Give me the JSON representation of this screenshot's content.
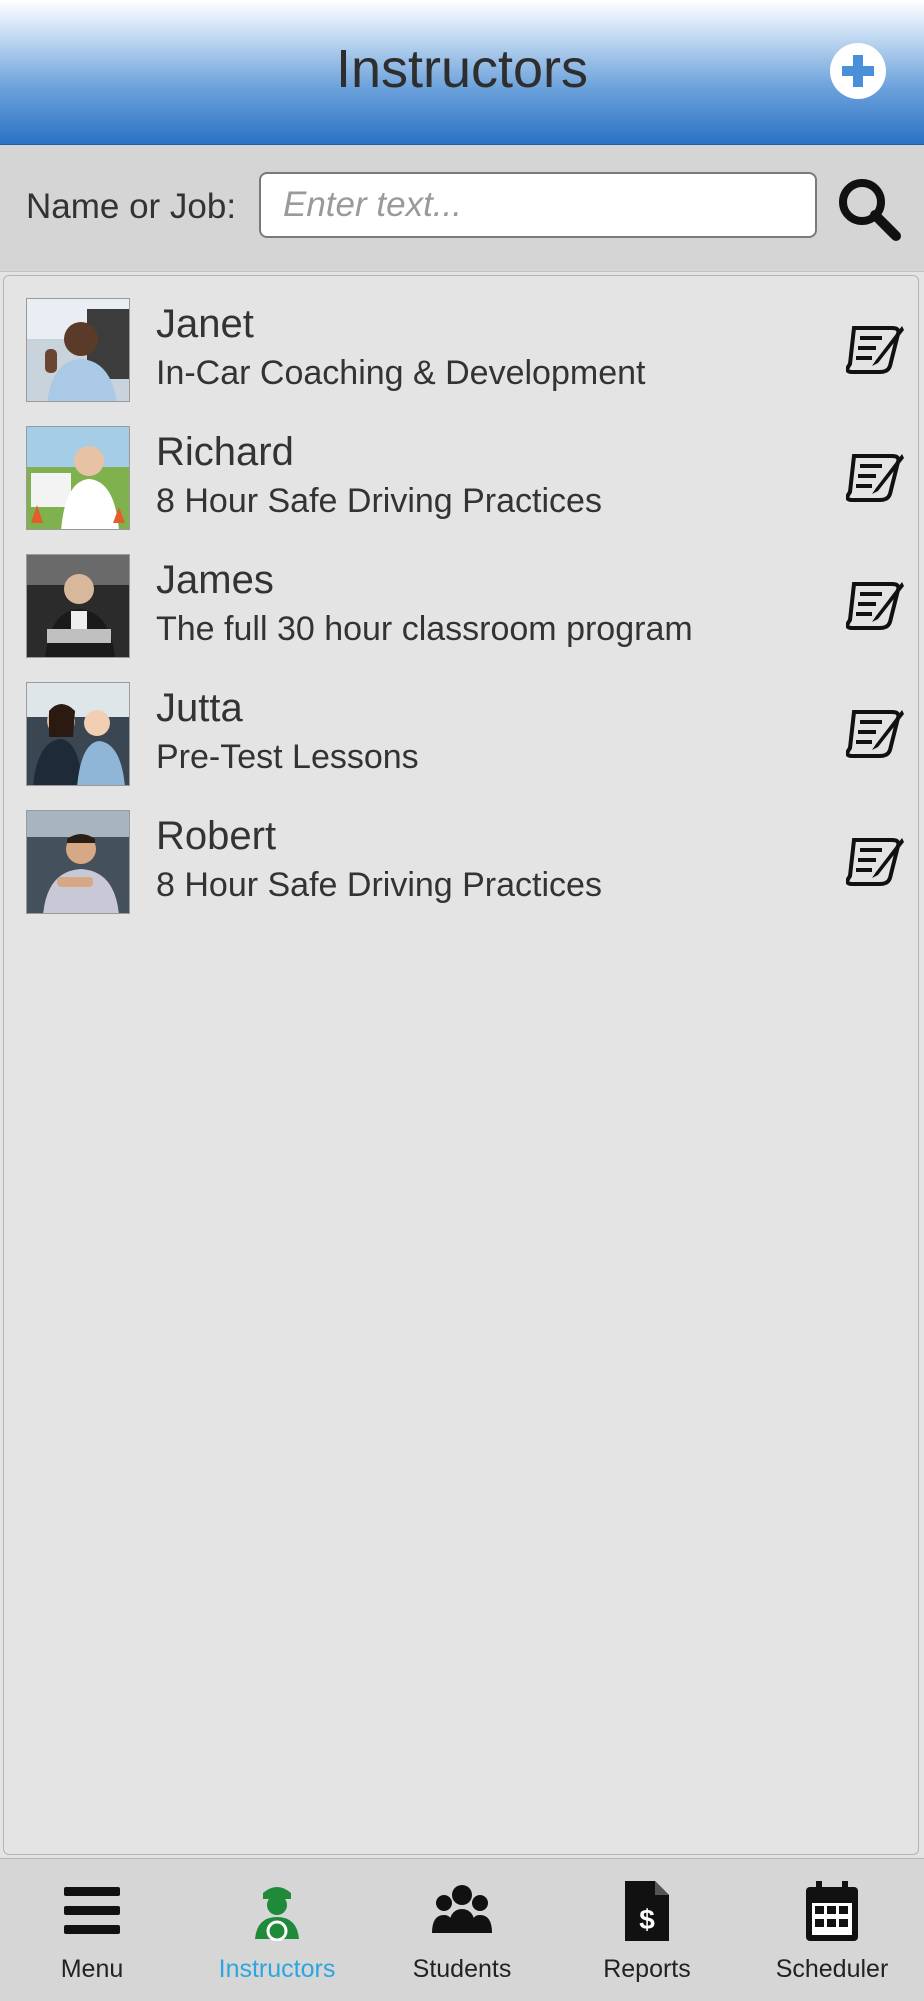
{
  "header": {
    "title": "Instructors",
    "add_icon": "plus-circle-icon"
  },
  "search": {
    "label": "Name or Job:",
    "placeholder": "Enter text...",
    "icon": "search-icon"
  },
  "instructors": [
    {
      "name": "Janet",
      "job": "In-Car Coaching & Development"
    },
    {
      "name": "Richard",
      "job": "8 Hour Safe Driving Practices"
    },
    {
      "name": "James",
      "job": "The full 30 hour classroom program"
    },
    {
      "name": "Jutta",
      "job": "Pre-Test Lessons"
    },
    {
      "name": "Robert",
      "job": "8 Hour Safe Driving Practices"
    }
  ],
  "tabs": [
    {
      "label": "Menu",
      "icon": "hamburger-icon"
    },
    {
      "label": "Instructors",
      "icon": "driver-icon",
      "active": true
    },
    {
      "label": "Students",
      "icon": "group-icon"
    },
    {
      "label": "Reports",
      "icon": "invoice-icon"
    },
    {
      "label": "Scheduler",
      "icon": "calendar-icon"
    }
  ],
  "colors": {
    "accent": "#2da5e0",
    "header_blue": "#2a72c4",
    "active_icon": "#1e8a3a"
  }
}
